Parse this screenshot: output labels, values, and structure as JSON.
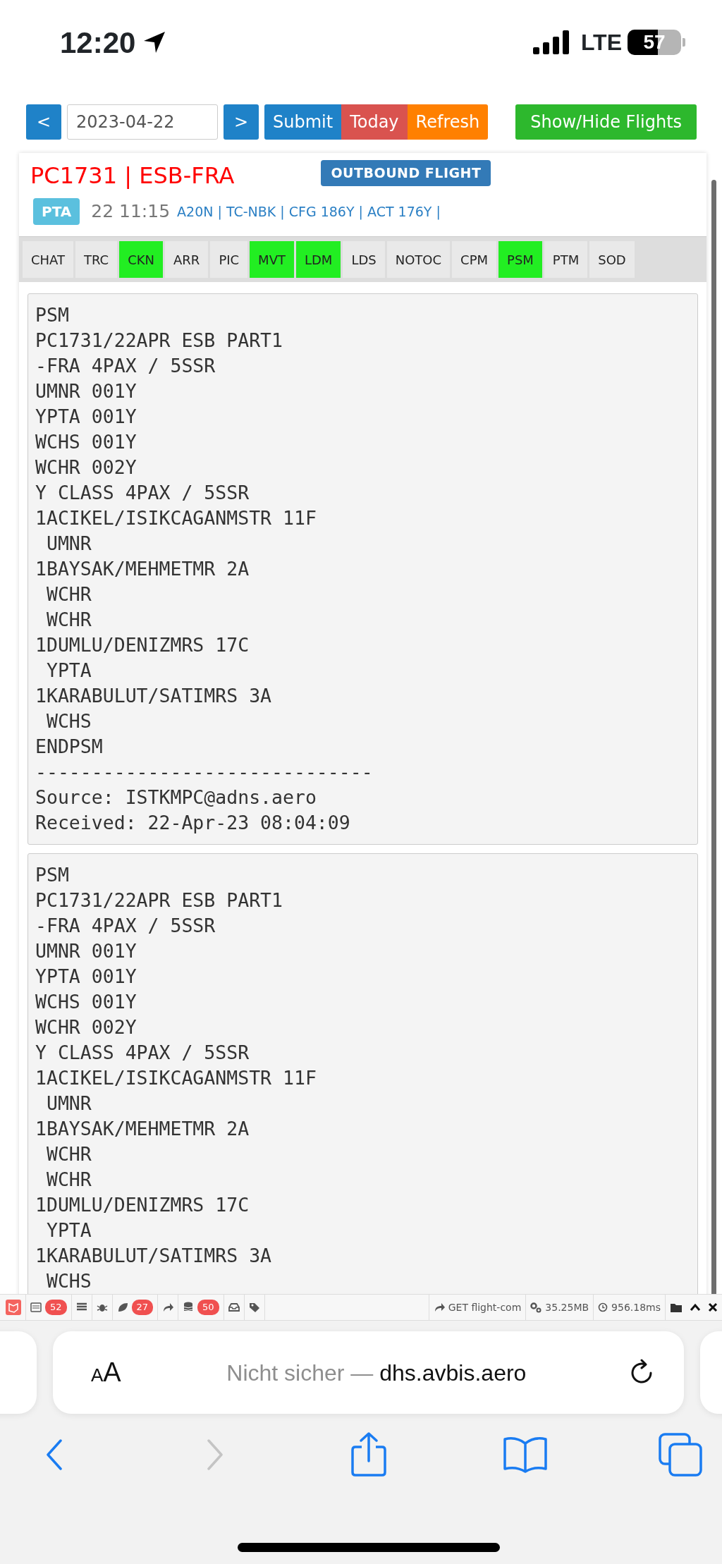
{
  "status_bar": {
    "time": "12:20",
    "network": "LTE",
    "battery": "57"
  },
  "controls": {
    "prev": "<",
    "date": "2023-04-22",
    "next": ">",
    "buttons": [
      {
        "label": "Submit",
        "color": "#1f82c8"
      },
      {
        "label": "Today",
        "color": "#d9534f"
      },
      {
        "label": "Refresh",
        "color": "#ff8000"
      }
    ],
    "toggle": "Show/Hide Flights"
  },
  "flight": {
    "title": "PC1731 | ESB-FRA",
    "direction": "OUTBOUND FLIGHT",
    "time_label": "PTA",
    "time": "22 11:15",
    "details": "A20N | TC-NBK | CFG 186Y | ACT 176Y |"
  },
  "tabs": [
    {
      "label": "CHAT",
      "has_data": false
    },
    {
      "label": "TRC",
      "has_data": false
    },
    {
      "label": "CKN",
      "has_data": true
    },
    {
      "label": "ARR",
      "has_data": false
    },
    {
      "label": "PIC",
      "has_data": false
    },
    {
      "label": "MVT",
      "has_data": true
    },
    {
      "label": "LDM",
      "has_data": true
    },
    {
      "label": "LDS",
      "has_data": false
    },
    {
      "label": "NOTOC",
      "has_data": false
    },
    {
      "label": "CPM",
      "has_data": false
    },
    {
      "label": "PSM",
      "has_data": true
    },
    {
      "label": "PTM",
      "has_data": false
    },
    {
      "label": "SOD",
      "has_data": false
    }
  ],
  "messages": [
    {
      "lines": [
        "PSM",
        "PC1731/22APR ESB PART1",
        "-FRA 4PAX / 5SSR",
        "UMNR 001Y",
        "YPTA 001Y",
        "WCHS 001Y",
        "WCHR 002Y",
        "Y CLASS 4PAX / 5SSR",
        "1ACIKEL/ISIKCAGANMSTR 11F",
        " UMNR",
        "1BAYSAK/MEHMETMR 2A",
        " WCHR",
        " WCHR",
        "1DUMLU/DENIZMRS 17C",
        " YPTA",
        "1KARABULUT/SATIMRS 3A",
        " WCHS",
        "ENDPSM",
        "------------------------------",
        "Source: ISTKMPC@adns.aero",
        "Received: 22-Apr-23 08:04:09"
      ]
    },
    {
      "lines": [
        "PSM",
        "PC1731/22APR ESB PART1",
        "-FRA 4PAX / 5SSR",
        "UMNR 001Y",
        "YPTA 001Y",
        "WCHS 001Y",
        "WCHR 002Y",
        "Y CLASS 4PAX / 5SSR",
        "1ACIKEL/ISIKCAGANMSTR 11F",
        " UMNR",
        "1BAYSAK/MEHMETMR 2A",
        " WCHR",
        " WCHR",
        "1DUMLU/DENIZMRS 17C",
        " YPTA",
        "1KARABULUT/SATIMRS 3A",
        " WCHS"
      ]
    }
  ],
  "debug_bar": {
    "counts": [
      "52",
      "27",
      "50"
    ],
    "route": "GET flight-com",
    "memory": "35.25MB",
    "duration": "956.18ms"
  },
  "browser": {
    "text_size": "AA",
    "security": "Nicht sicher —",
    "host": "dhs.avbis.aero"
  }
}
